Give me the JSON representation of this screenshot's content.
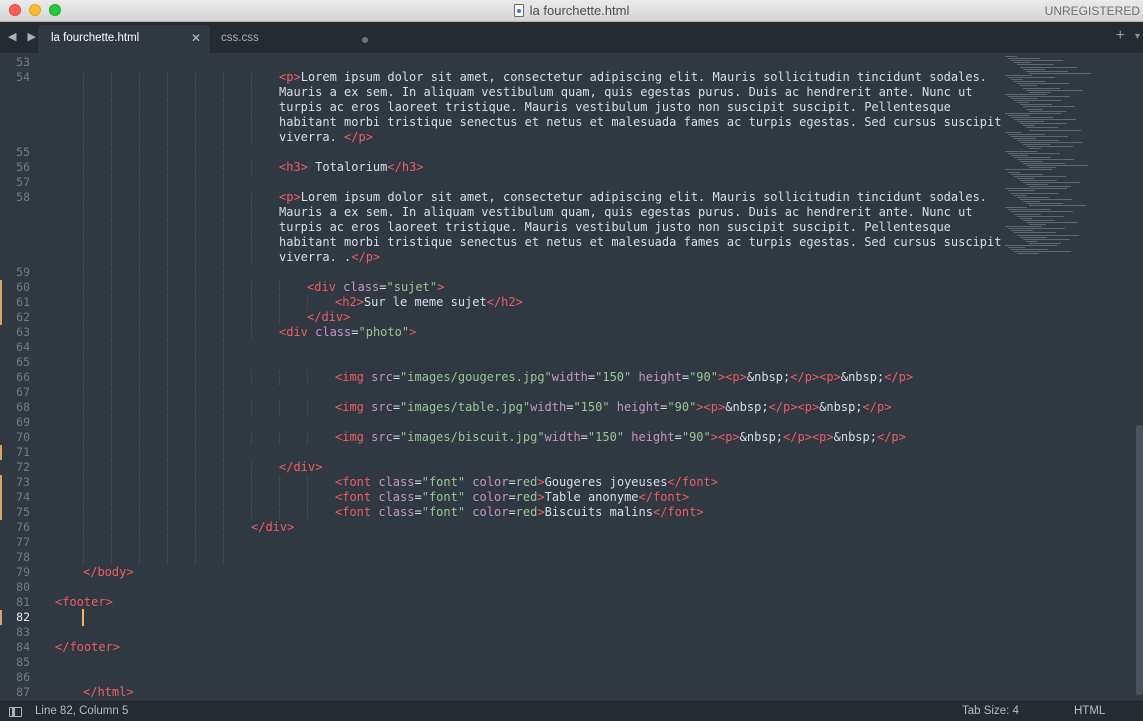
{
  "window": {
    "title": "la fourchette.html",
    "license_status": "UNREGISTERED",
    "file_icon": "html-file-icon"
  },
  "tabs": [
    {
      "label": "la fourchette.html",
      "active": true
    },
    {
      "label": "css.css",
      "active": false
    }
  ],
  "tab_controls": {
    "back_forward": "◀ ▶",
    "close_glyph": "✕",
    "new_tab_glyph": "+",
    "dropdown_glyph": "▾"
  },
  "colors": {
    "background": "#303841",
    "tag": "#ec5f66",
    "attribute": "#c695c6",
    "string": "#99c794",
    "text": "#d8dee9",
    "cursor": "#f9ae58",
    "modified_marker": "#d1a367"
  },
  "editor": {
    "lines": [
      {
        "n": "53",
        "indent": 0,
        "tokens": []
      },
      {
        "n": "54",
        "indent": 32,
        "tokens": [
          [
            "tg",
            "<p>"
          ],
          [
            "tx",
            "Lorem ipsum dolor sit amet, consectetur adipiscing elit. Mauris sollicitudin tincidunt sodales."
          ]
        ]
      },
      {
        "n": "",
        "indent": 32,
        "tokens": [
          [
            "tx",
            "Mauris a ex sem. In aliquam vestibulum quam, quis egestas purus. Duis ac hendrerit ante. Nunc ut"
          ]
        ]
      },
      {
        "n": "",
        "indent": 32,
        "tokens": [
          [
            "tx",
            "turpis ac eros laoreet tristique. Mauris vestibulum justo non suscipit suscipit. Pellentesque"
          ]
        ]
      },
      {
        "n": "",
        "indent": 32,
        "tokens": [
          [
            "tx",
            "habitant morbi tristique senectus et netus et malesuada fames ac turpis egestas. Sed cursus suscipit"
          ]
        ]
      },
      {
        "n": "",
        "indent": 32,
        "tokens": [
          [
            "tx",
            "viverra. "
          ],
          [
            "tg",
            "</p>"
          ]
        ]
      },
      {
        "n": "55",
        "indent": 0,
        "tokens": []
      },
      {
        "n": "56",
        "indent": 32,
        "tokens": [
          [
            "tg",
            "<h3>"
          ],
          [
            "tx",
            " Totalorium"
          ],
          [
            "tg",
            "</h3>"
          ]
        ]
      },
      {
        "n": "57",
        "indent": 0,
        "tokens": []
      },
      {
        "n": "58",
        "indent": 32,
        "tokens": [
          [
            "tg",
            "<p>"
          ],
          [
            "tx",
            "Lorem ipsum dolor sit amet, consectetur adipiscing elit. Mauris sollicitudin tincidunt sodales."
          ]
        ]
      },
      {
        "n": "",
        "indent": 32,
        "tokens": [
          [
            "tx",
            "Mauris a ex sem. In aliquam vestibulum quam, quis egestas purus. Duis ac hendrerit ante. Nunc ut"
          ]
        ]
      },
      {
        "n": "",
        "indent": 32,
        "tokens": [
          [
            "tx",
            "turpis ac eros laoreet tristique. Mauris vestibulum justo non suscipit suscipit. Pellentesque"
          ]
        ]
      },
      {
        "n": "",
        "indent": 32,
        "tokens": [
          [
            "tx",
            "habitant morbi tristique senectus et netus et malesuada fames ac turpis egestas. Sed cursus suscipit"
          ]
        ]
      },
      {
        "n": "",
        "indent": 32,
        "tokens": [
          [
            "tx",
            "viverra. ."
          ],
          [
            "tg",
            "</p>"
          ]
        ]
      },
      {
        "n": "59",
        "indent": 0,
        "tokens": []
      },
      {
        "n": "60",
        "indent": 36,
        "modified": true,
        "tokens": [
          [
            "tg",
            "<div"
          ],
          [
            "at",
            " class"
          ],
          [
            "tx",
            "="
          ],
          [
            "st",
            "\"sujet\""
          ],
          [
            "tg",
            ">"
          ]
        ]
      },
      {
        "n": "61",
        "indent": 40,
        "modified": true,
        "tokens": [
          [
            "tg",
            "<h2>"
          ],
          [
            "tx",
            "Sur le meme sujet"
          ],
          [
            "tg",
            "</h2>"
          ]
        ]
      },
      {
        "n": "62",
        "indent": 36,
        "modified": true,
        "tokens": [
          [
            "tg",
            "</div>"
          ]
        ]
      },
      {
        "n": "63",
        "indent": 32,
        "tokens": [
          [
            "tg",
            "<div"
          ],
          [
            "at",
            " class"
          ],
          [
            "tx",
            "="
          ],
          [
            "st",
            "\"photo\""
          ],
          [
            "tg",
            ">"
          ]
        ]
      },
      {
        "n": "64",
        "indent": 0,
        "tokens": []
      },
      {
        "n": "65",
        "indent": 0,
        "tokens": []
      },
      {
        "n": "66",
        "indent": 40,
        "tokens": [
          [
            "tg",
            "<img"
          ],
          [
            "at",
            " src"
          ],
          [
            "tx",
            "="
          ],
          [
            "st",
            "\"images/gougeres.jpg\""
          ],
          [
            "at",
            "width"
          ],
          [
            "tx",
            "="
          ],
          [
            "st",
            "\"150\""
          ],
          [
            "at",
            " height"
          ],
          [
            "tx",
            "="
          ],
          [
            "st",
            "\"90\""
          ],
          [
            "tg",
            ">"
          ],
          [
            "tg",
            "<p>"
          ],
          [
            "ent",
            "&nbsp;"
          ],
          [
            "tg",
            "</p>"
          ],
          [
            "tg",
            "<p>"
          ],
          [
            "ent",
            "&nbsp;"
          ],
          [
            "tg",
            "</p>"
          ]
        ]
      },
      {
        "n": "67",
        "indent": 0,
        "tokens": []
      },
      {
        "n": "68",
        "indent": 40,
        "tokens": [
          [
            "tg",
            "<img"
          ],
          [
            "at",
            " src"
          ],
          [
            "tx",
            "="
          ],
          [
            "st",
            "\"images/table.jpg\""
          ],
          [
            "at",
            "width"
          ],
          [
            "tx",
            "="
          ],
          [
            "st",
            "\"150\""
          ],
          [
            "at",
            " height"
          ],
          [
            "tx",
            "="
          ],
          [
            "st",
            "\"90\""
          ],
          [
            "tg",
            ">"
          ],
          [
            "tg",
            "<p>"
          ],
          [
            "ent",
            "&nbsp;"
          ],
          [
            "tg",
            "</p>"
          ],
          [
            "tg",
            "<p>"
          ],
          [
            "ent",
            "&nbsp;"
          ],
          [
            "tg",
            "</p>"
          ]
        ]
      },
      {
        "n": "69",
        "indent": 0,
        "tokens": []
      },
      {
        "n": "70",
        "indent": 40,
        "tokens": [
          [
            "tg",
            "<img"
          ],
          [
            "at",
            " src"
          ],
          [
            "tx",
            "="
          ],
          [
            "st",
            "\"images/biscuit.jpg\""
          ],
          [
            "at",
            "width"
          ],
          [
            "tx",
            "="
          ],
          [
            "st",
            "\"150\""
          ],
          [
            "at",
            " height"
          ],
          [
            "tx",
            "="
          ],
          [
            "st",
            "\"90\""
          ],
          [
            "tg",
            ">"
          ],
          [
            "tg",
            "<p>"
          ],
          [
            "ent",
            "&nbsp;"
          ],
          [
            "tg",
            "</p>"
          ],
          [
            "tg",
            "<p>"
          ],
          [
            "ent",
            "&nbsp;"
          ],
          [
            "tg",
            "</p>"
          ]
        ]
      },
      {
        "n": "71",
        "indent": 0,
        "modified": true,
        "tokens": []
      },
      {
        "n": "72",
        "indent": 32,
        "tokens": [
          [
            "tg",
            "</div>"
          ]
        ]
      },
      {
        "n": "73",
        "indent": 40,
        "modified": true,
        "tokens": [
          [
            "tg",
            "<font"
          ],
          [
            "at",
            " class"
          ],
          [
            "tx",
            "="
          ],
          [
            "st",
            "\"font\""
          ],
          [
            "at",
            " color"
          ],
          [
            "tx",
            "="
          ],
          [
            "st",
            "red"
          ],
          [
            "tg",
            ">"
          ],
          [
            "tx",
            "Gougeres joyeuses"
          ],
          [
            "tg",
            "</font>"
          ]
        ]
      },
      {
        "n": "74",
        "indent": 40,
        "modified": true,
        "tokens": [
          [
            "tg",
            "<font"
          ],
          [
            "at",
            " class"
          ],
          [
            "tx",
            "="
          ],
          [
            "st",
            "\"font\""
          ],
          [
            "at",
            " color"
          ],
          [
            "tx",
            "="
          ],
          [
            "st",
            "red"
          ],
          [
            "tg",
            ">"
          ],
          [
            "tx",
            "Table anonyme"
          ],
          [
            "tg",
            "</font>"
          ]
        ]
      },
      {
        "n": "75",
        "indent": 40,
        "modified": true,
        "tokens": [
          [
            "tg",
            "<font"
          ],
          [
            "at",
            " class"
          ],
          [
            "tx",
            "="
          ],
          [
            "st",
            "\"font\""
          ],
          [
            "at",
            " color"
          ],
          [
            "tx",
            "="
          ],
          [
            "st",
            "red"
          ],
          [
            "tg",
            ">"
          ],
          [
            "tx",
            "Biscuits malins"
          ],
          [
            "tg",
            "</font>"
          ]
        ]
      },
      {
        "n": "76",
        "indent": 28,
        "tokens": [
          [
            "tg",
            "</div>"
          ]
        ]
      },
      {
        "n": "77",
        "indent": 0,
        "tokens": []
      },
      {
        "n": "78",
        "indent": 0,
        "tokens": []
      },
      {
        "n": "79",
        "indent": 4,
        "tokens": [
          [
            "tg",
            "</body>"
          ]
        ]
      },
      {
        "n": "80",
        "indent": 0,
        "tokens": []
      },
      {
        "n": "81",
        "indent": 0,
        "tokens": [
          [
            "tg",
            "<footer>"
          ]
        ]
      },
      {
        "n": "82",
        "indent": 0,
        "current": true,
        "modified": true,
        "tokens": []
      },
      {
        "n": "83",
        "indent": 0,
        "tokens": []
      },
      {
        "n": "84",
        "indent": 0,
        "tokens": [
          [
            "tg",
            "</footer>"
          ]
        ]
      },
      {
        "n": "85",
        "indent": 0,
        "tokens": []
      },
      {
        "n": "86",
        "indent": 0,
        "tokens": []
      },
      {
        "n": "87",
        "indent": 4,
        "tokens": [
          [
            "tg",
            "</html>"
          ]
        ]
      }
    ]
  },
  "status_bar": {
    "position": "Line 82, Column 5",
    "tab_size": "Tab Size: 4",
    "syntax": "HTML",
    "panel_toggle_icon": "sidebar-toggle-icon"
  }
}
